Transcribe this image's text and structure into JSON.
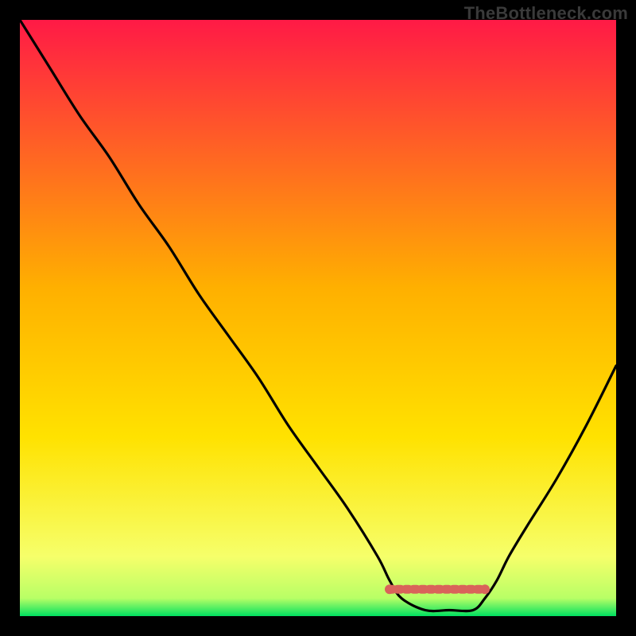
{
  "watermark": "TheBottleneck.com",
  "chart_data": {
    "type": "line",
    "title": "",
    "xlabel": "",
    "ylabel": "",
    "xlim": [
      0,
      100
    ],
    "ylim": [
      0,
      100
    ],
    "series": [
      {
        "name": "curve",
        "x": [
          0,
          5,
          10,
          15,
          20,
          25,
          30,
          35,
          40,
          45,
          50,
          55,
          60,
          62,
          64,
          68,
          72,
          76,
          78,
          80,
          82,
          85,
          90,
          95,
          100
        ],
        "y": [
          100,
          92,
          84,
          77,
          69,
          62,
          54,
          47,
          40,
          32,
          25,
          18,
          10,
          6,
          3,
          1,
          1,
          1,
          3,
          6,
          10,
          15,
          23,
          32,
          42
        ]
      },
      {
        "name": "marker-segment",
        "x": [
          62,
          78
        ],
        "y": [
          4.5,
          4.5
        ]
      }
    ],
    "background_gradient": {
      "top": "#ff1a46",
      "mid": "#ffd400",
      "near_bottom": "#f6ff6a",
      "bottom": "#00e060"
    },
    "marker_color": "#d9635a"
  }
}
